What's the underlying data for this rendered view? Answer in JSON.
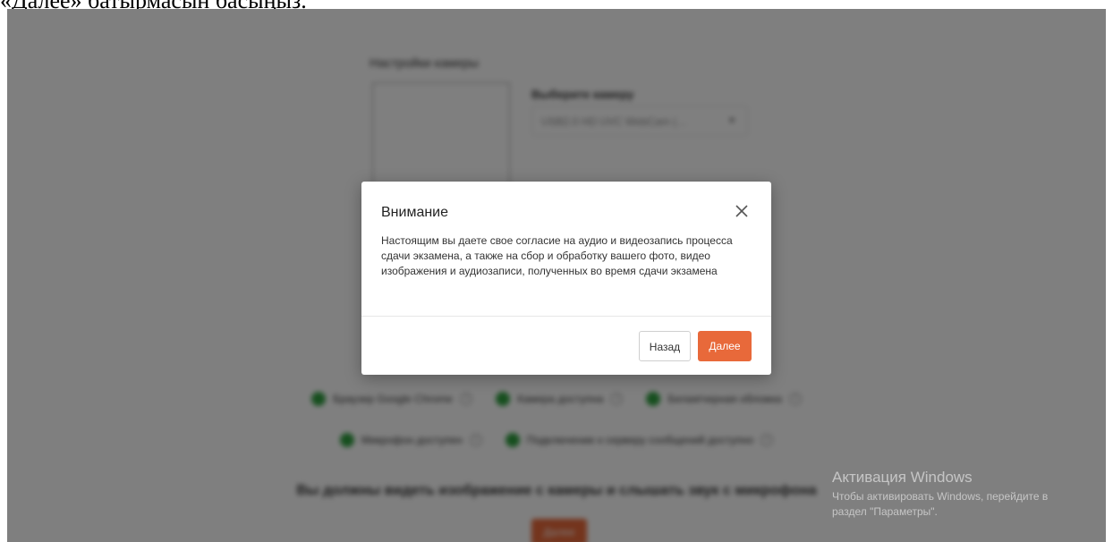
{
  "doc_caption": "«Далее» батырмасын басыңыз.",
  "background": {
    "section_title": "Настройки камеры",
    "select_label": "Выберите камеру",
    "select_value": "USB2.0 HD UVC WebCam (…",
    "checks_row1": [
      {
        "label": "Браузер Google Chrome"
      },
      {
        "label": "Камера доступна"
      },
      {
        "label": "Белая/черная обложка"
      }
    ],
    "checks_row2": [
      {
        "label": "Микрофон доступен"
      },
      {
        "label": "Подключение к серверу сообщений доступно"
      }
    ],
    "bottom_text": "Вы должны видеть изображение с камеры и слышать звук с микрофона",
    "bottom_button": "Далее",
    "check_color": "#2e9e3e",
    "accent": "#e8693a"
  },
  "modal": {
    "title": "Внимание",
    "body": "Настоящим вы даете свое согласие на аудио и видеозапись процесса сдачи экзамена, а также на сбор и обработку вашего фото, видео изображения и аудиозаписи, полученных во время сдачи экзамена",
    "back_label": "Назад",
    "next_label": "Далее",
    "close_icon": "close-icon"
  },
  "watermark": {
    "title": "Активация Windows",
    "subtitle_line1": "Чтобы активировать Windows, перейдите в",
    "subtitle_line2": "раздел \"Параметры\"."
  }
}
